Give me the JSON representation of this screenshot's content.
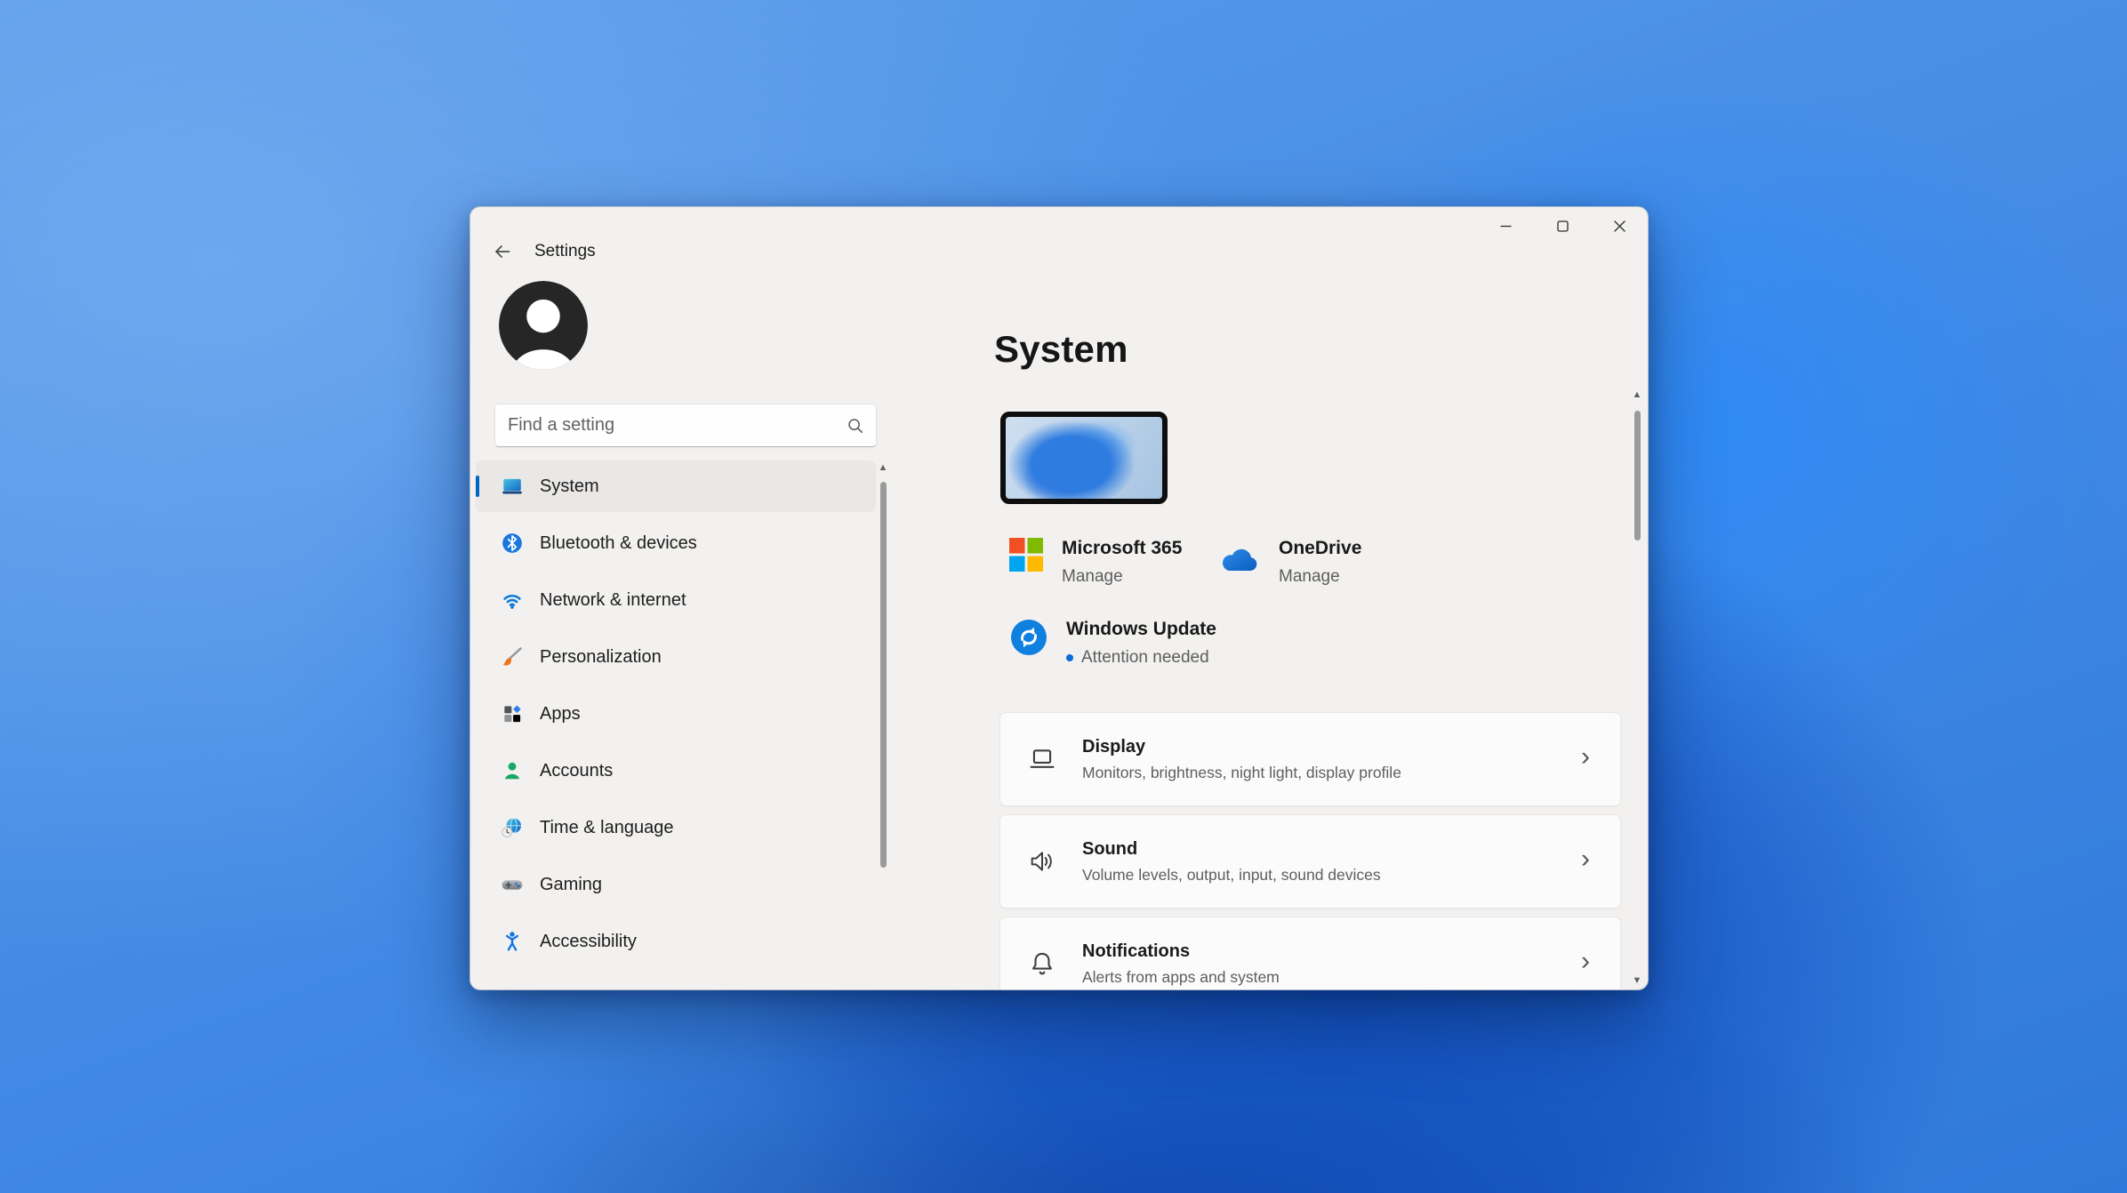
{
  "window": {
    "title": "Settings",
    "controls": [
      {
        "name": "minimize"
      },
      {
        "name": "maximize"
      },
      {
        "name": "close"
      }
    ]
  },
  "search": {
    "placeholder": "Find a setting"
  },
  "sidebar": {
    "items": [
      {
        "label": "System",
        "icon": "system-icon",
        "selected": true
      },
      {
        "label": "Bluetooth & devices",
        "icon": "bluetooth-icon",
        "selected": false
      },
      {
        "label": "Network & internet",
        "icon": "network-icon",
        "selected": false
      },
      {
        "label": "Personalization",
        "icon": "personalization-icon",
        "selected": false
      },
      {
        "label": "Apps",
        "icon": "apps-icon",
        "selected": false
      },
      {
        "label": "Accounts",
        "icon": "accounts-icon",
        "selected": false
      },
      {
        "label": "Time & language",
        "icon": "time-language-icon",
        "selected": false
      },
      {
        "label": "Gaming",
        "icon": "gaming-icon",
        "selected": false
      },
      {
        "label": "Accessibility",
        "icon": "accessibility-icon",
        "selected": false
      }
    ]
  },
  "main": {
    "title": "System",
    "quick_links": [
      {
        "title": "Microsoft 365",
        "subtitle": "Manage",
        "icon": "microsoft-365-icon"
      },
      {
        "title": "OneDrive",
        "subtitle": "Manage",
        "icon": "onedrive-icon"
      }
    ],
    "windows_update": {
      "title": "Windows Update",
      "status": "Attention needed"
    },
    "cards": [
      {
        "title": "Display",
        "subtitle": "Monitors, brightness, night light, display profile",
        "icon": "display-icon"
      },
      {
        "title": "Sound",
        "subtitle": "Volume levels, output, input, sound devices",
        "icon": "sound-icon"
      },
      {
        "title": "Notifications",
        "subtitle": "Alerts from apps and system",
        "icon": "notifications-icon"
      }
    ]
  },
  "icons": {
    "chevron_right": "›",
    "scroll_up": "▲",
    "scroll_down": "▼"
  },
  "colors": {
    "accent": "#0067c0",
    "update_badge": "#0f80df",
    "status_dot": "#0a6cd6",
    "ms_red": "#f25022",
    "ms_green": "#7fba00",
    "ms_blue": "#00a4ef",
    "ms_yellow": "#ffb900",
    "onedrive_blue": "#0d6cc0"
  }
}
